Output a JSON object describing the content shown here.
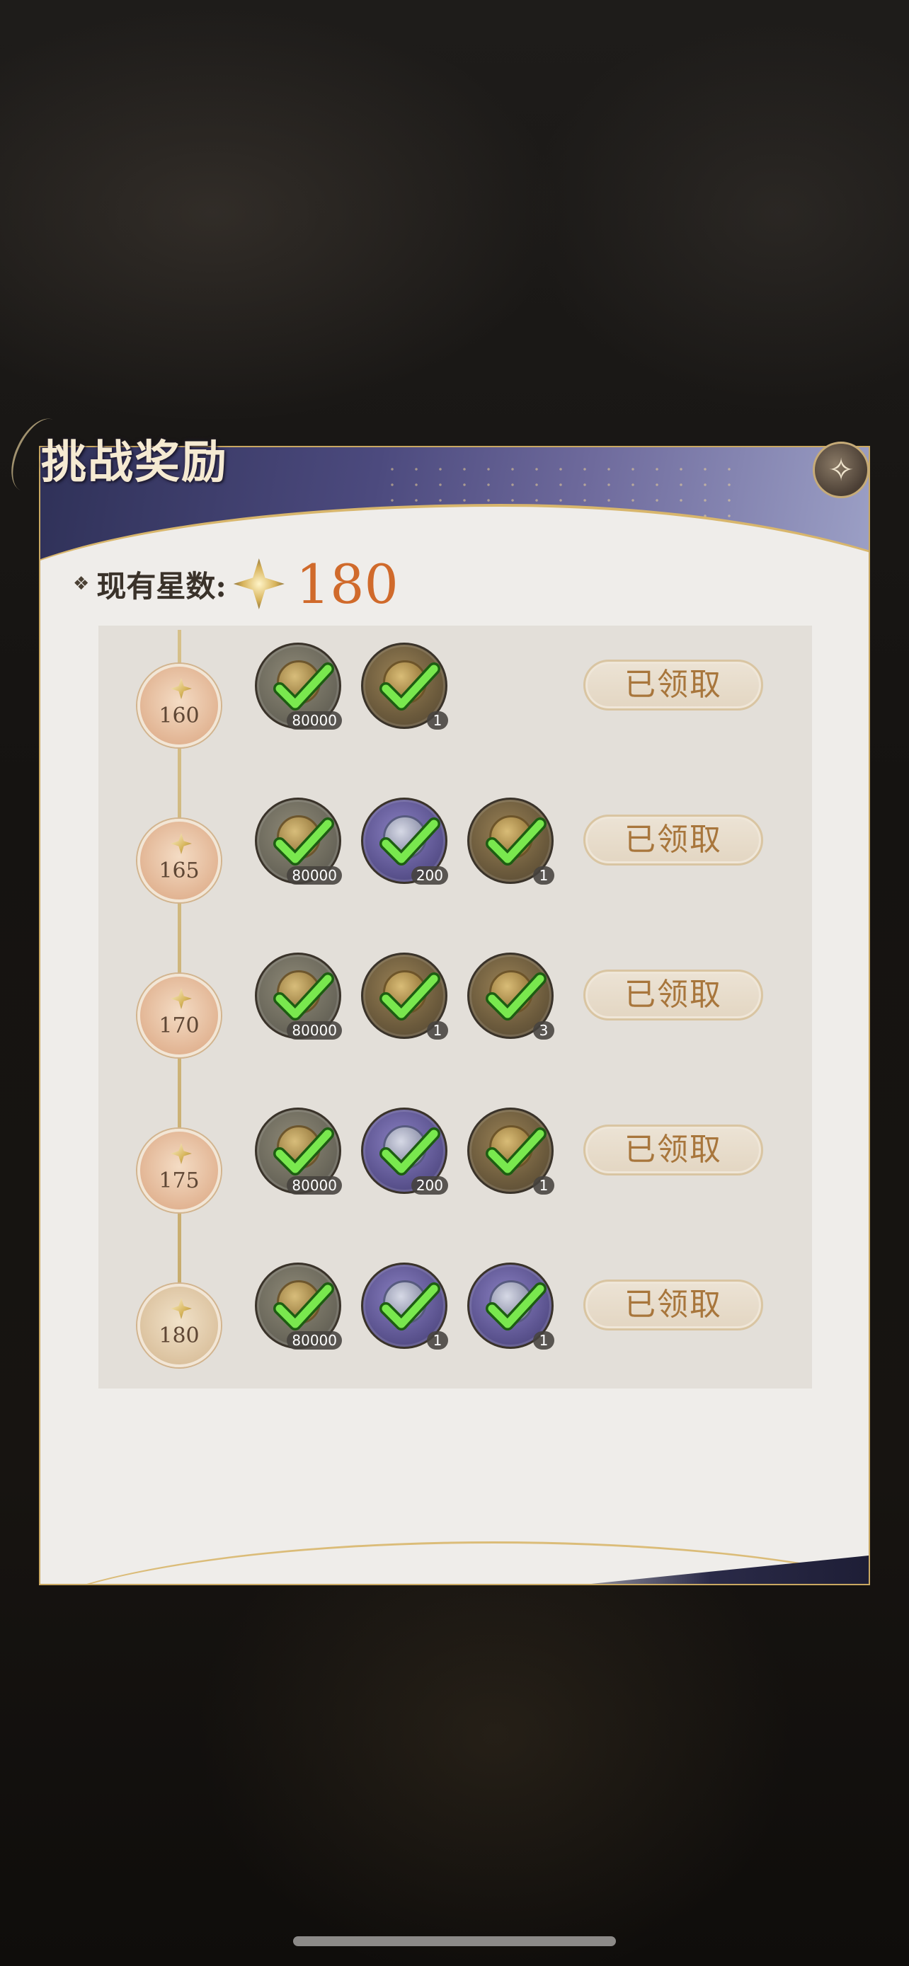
{
  "dialog": {
    "title": "挑战奖励",
    "close_icon_glyph": "✧",
    "bullet_glyph": "❖",
    "stars_label": "现有星数:",
    "stars_value": "180"
  },
  "rows": [
    {
      "tier": "160",
      "button": "已领取",
      "items": [
        {
          "icon": "coin-icon",
          "count": "80000"
        },
        {
          "icon": "herb-bundle-icon",
          "count": "1"
        }
      ]
    },
    {
      "tier": "165",
      "button": "已领取",
      "items": [
        {
          "icon": "coin-icon",
          "count": "80000"
        },
        {
          "icon": "spirit-orb-icon",
          "count": "200"
        },
        {
          "icon": "token-chain-icon",
          "count": "1"
        }
      ]
    },
    {
      "tier": "170",
      "button": "已领取",
      "items": [
        {
          "icon": "coin-icon",
          "count": "80000"
        },
        {
          "icon": "herb-bundle-icon",
          "count": "1"
        },
        {
          "icon": "scroll-bar-icon",
          "count": "3"
        }
      ]
    },
    {
      "tier": "175",
      "button": "已领取",
      "items": [
        {
          "icon": "coin-icon",
          "count": "80000"
        },
        {
          "icon": "spirit-orb-icon",
          "count": "200"
        },
        {
          "icon": "token-chain-icon",
          "count": "1"
        }
      ]
    },
    {
      "tier": "180",
      "button": "已领取",
      "items": [
        {
          "icon": "coin-icon",
          "count": "80000"
        },
        {
          "icon": "scroll-icon",
          "count": "1"
        },
        {
          "icon": "ring-icon",
          "count": "1"
        }
      ]
    }
  ],
  "colors": {
    "stars_value": "#d06a2b",
    "claimed_text": "#a8763c",
    "check": "#79e84e"
  }
}
